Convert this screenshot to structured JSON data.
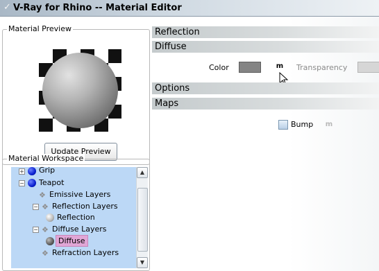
{
  "window": {
    "title": "V-Ray for Rhino -- Material Editor"
  },
  "preview": {
    "legend": "Material Preview",
    "update_button": "Update Preview"
  },
  "workspace": {
    "legend": "Material Workspace",
    "tree": [
      {
        "label": "Grip"
      },
      {
        "label": "Teapot"
      },
      {
        "label": "Emissive Layers"
      },
      {
        "label": "Reflection Layers"
      },
      {
        "label": "Reflection"
      },
      {
        "label": "Diffuse Layers"
      },
      {
        "label": "Diffuse"
      },
      {
        "label": "Refraction Layers"
      }
    ]
  },
  "panel": {
    "reflection_header": "Reflection",
    "diffuse_header": "Diffuse",
    "color_label": "Color",
    "color_swatch": "#848484",
    "map_button": "m",
    "transparency_label": "Transparency",
    "transparency_swatch": "#d6d6d6",
    "options_header": "Options",
    "maps_header": "Maps",
    "bump_label": "Bump",
    "bump_map_button": "m"
  }
}
